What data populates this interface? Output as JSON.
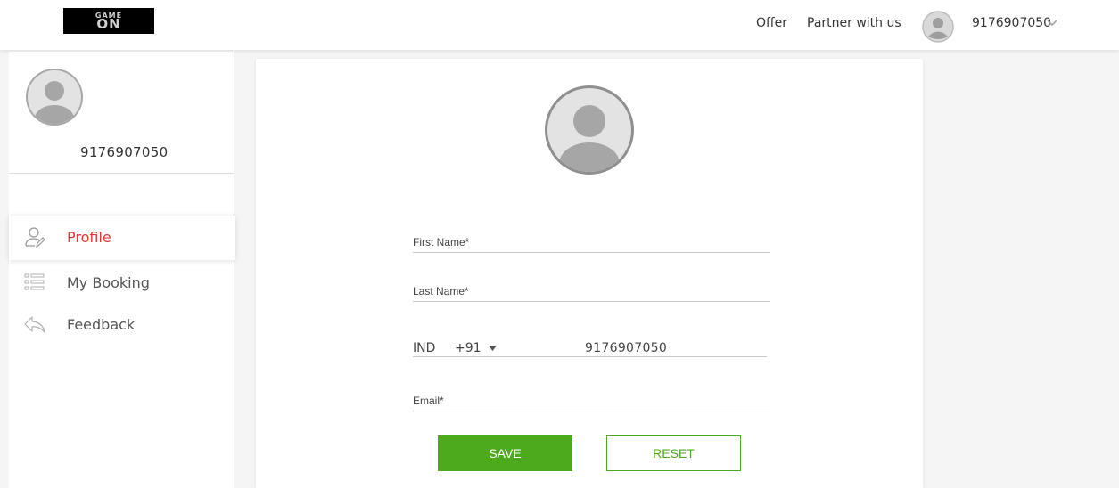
{
  "header": {
    "logo_top": "GAME",
    "logo_bottom": "ON",
    "nav": {
      "offer": "Offer",
      "partner": "Partner with us"
    },
    "user_phone": "9176907050"
  },
  "sidebar": {
    "user_phone": "9176907050",
    "menu": [
      {
        "label": "Profile",
        "icon": "user-edit-icon",
        "active": true
      },
      {
        "label": "My Booking",
        "icon": "list-icon",
        "active": false
      },
      {
        "label": "Feedback",
        "icon": "reply-arrow-icon",
        "active": false
      }
    ]
  },
  "form": {
    "first_name_placeholder": "First Name*",
    "last_name_placeholder": "Last Name*",
    "country": "IND",
    "dial_code": "+91",
    "phone": "9176907050",
    "email_placeholder": "Email*",
    "save_label": "SAVE",
    "reset_label": "RESET"
  },
  "colors": {
    "accent_green": "#4caa1c",
    "active_red": "#e53935",
    "avatar_gray": "#b5b5b5"
  }
}
